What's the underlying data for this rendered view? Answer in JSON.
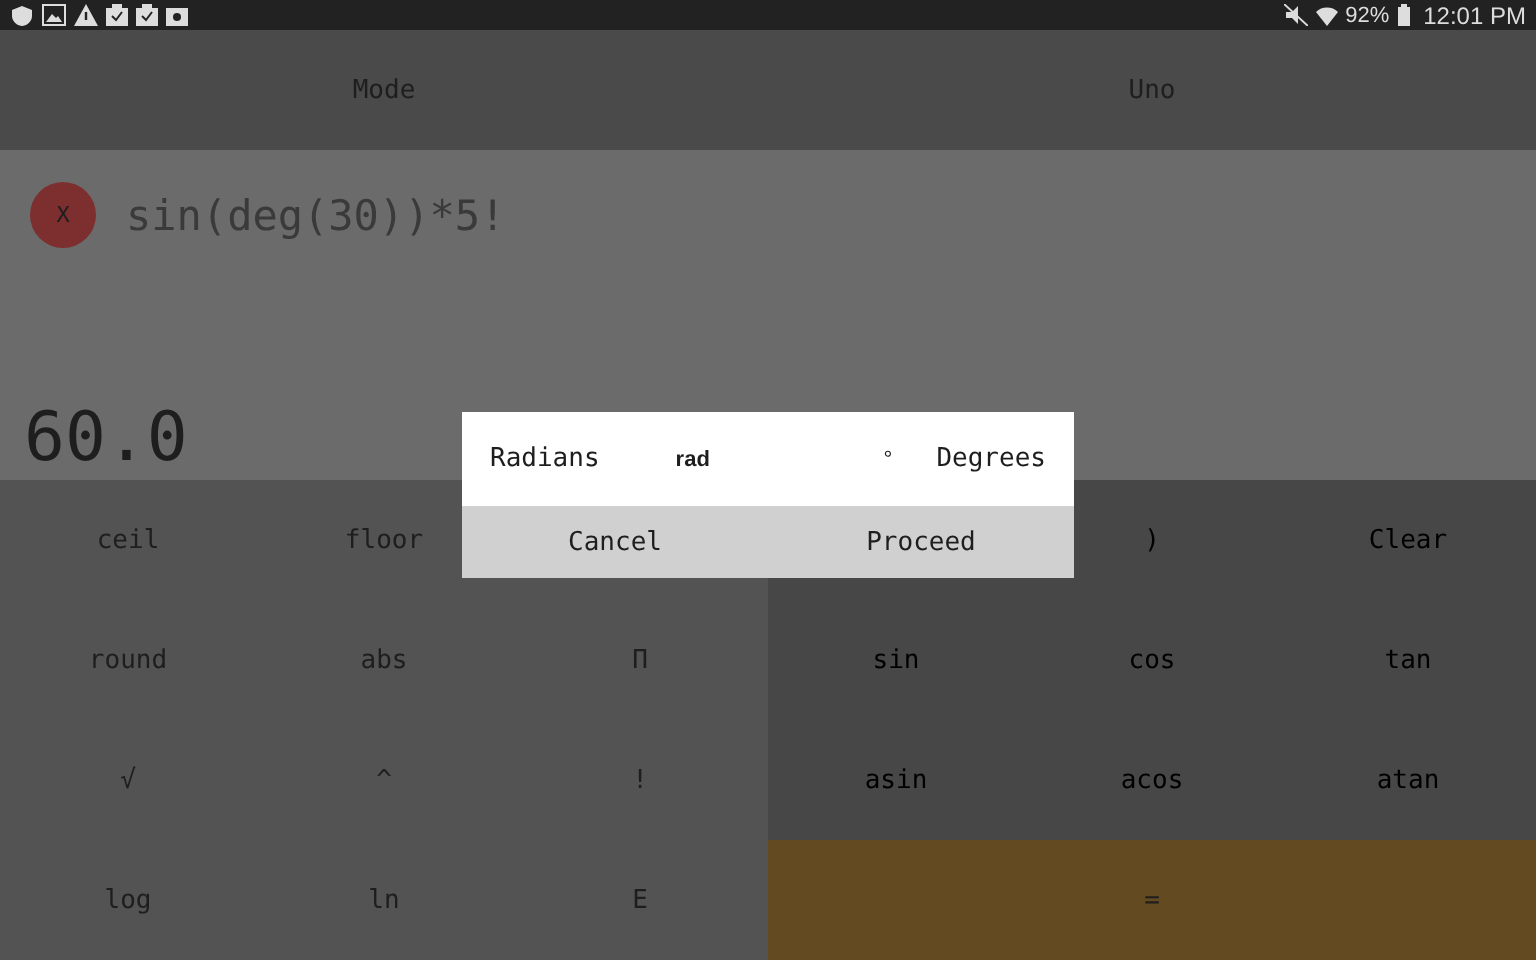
{
  "status_bar": {
    "battery": "92%",
    "time": "12:01 PM"
  },
  "top_bar": {
    "buttons": [
      "Mode",
      "Uno"
    ]
  },
  "display": {
    "clear_button": "X",
    "expression": "sin(deg(30))*5!",
    "result": "60.0"
  },
  "keypad": {
    "left": [
      [
        "ceil",
        "floor"
      ],
      [
        "round",
        "abs",
        "Π"
      ],
      [
        "√",
        "^",
        "!"
      ],
      [
        "log",
        "ln",
        "E"
      ]
    ],
    "right": [
      [
        {
          "label": ")",
          "kind": "trig"
        },
        {
          "label": "Clear",
          "kind": "trig"
        }
      ],
      [
        {
          "label": "sin",
          "kind": "trig"
        },
        {
          "label": "cos",
          "kind": "trig"
        },
        {
          "label": "tan",
          "kind": "trig"
        }
      ],
      [
        {
          "label": "asin",
          "kind": "trig"
        },
        {
          "label": "acos",
          "kind": "trig"
        },
        {
          "label": "atan",
          "kind": "trig"
        }
      ],
      [
        {
          "label": "=",
          "kind": "equals"
        }
      ]
    ]
  },
  "dialog": {
    "options": [
      {
        "label": "Radians",
        "symbol": "rad"
      },
      {
        "label": "Degrees",
        "symbol": "°"
      }
    ],
    "buttons": [
      "Cancel",
      "Proceed"
    ]
  }
}
